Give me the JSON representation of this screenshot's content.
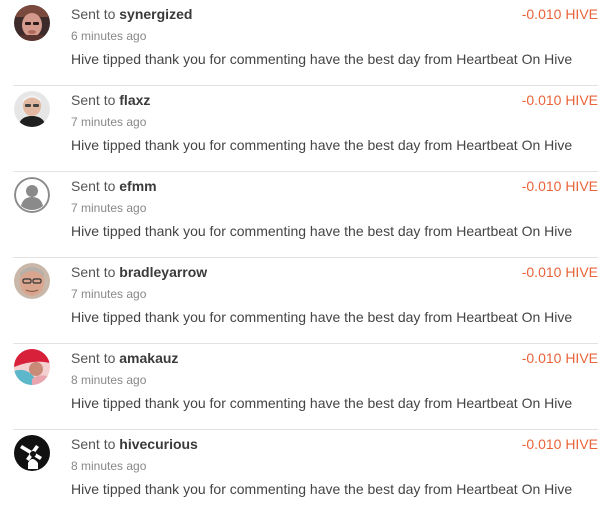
{
  "transactions": [
    {
      "prefix": "Sent to",
      "username": "synergized",
      "time": "6 minutes ago",
      "memo": "Hive tipped thank you for commenting have the best day from Heartbeat On Hive",
      "amount": "-0.010 HIVE",
      "avatar_icon": "user-photo-avatar"
    },
    {
      "prefix": "Sent to",
      "username": "flaxz",
      "time": "7 minutes ago",
      "memo": "Hive tipped thank you for commenting have the best day from Heartbeat On Hive",
      "amount": "-0.010 HIVE",
      "avatar_icon": "user-photo-avatar"
    },
    {
      "prefix": "Sent to",
      "username": "efmm",
      "time": "7 minutes ago",
      "memo": "Hive tipped thank you for commenting have the best day from Heartbeat On Hive",
      "amount": "-0.010 HIVE",
      "avatar_icon": "default-user-avatar"
    },
    {
      "prefix": "Sent to",
      "username": "bradleyarrow",
      "time": "7 minutes ago",
      "memo": "Hive tipped thank you for commenting have the best day from Heartbeat On Hive",
      "amount": "-0.010 HIVE",
      "avatar_icon": "user-photo-avatar"
    },
    {
      "prefix": "Sent to",
      "username": "amakauz",
      "time": "8 minutes ago",
      "memo": "Hive tipped thank you for commenting have the best day from Heartbeat On Hive",
      "amount": "-0.010 HIVE",
      "avatar_icon": "user-photo-avatar"
    },
    {
      "prefix": "Sent to",
      "username": "hivecurious",
      "time": "8 minutes ago",
      "memo": "Hive tipped thank you for commenting have the best day from Heartbeat On Hive",
      "amount": "-0.010 HIVE",
      "avatar_icon": "user-photo-avatar"
    }
  ],
  "colors": {
    "amount": "#e8643a",
    "divider": "#e2e2e2",
    "username": "#3a3a3a",
    "time": "#888888"
  }
}
